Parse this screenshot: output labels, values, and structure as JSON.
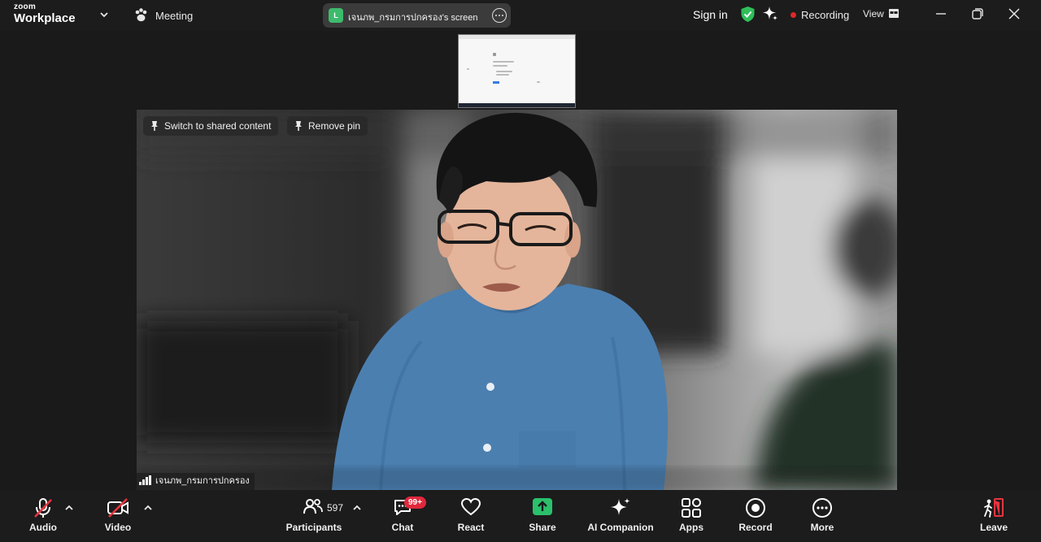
{
  "titlebar": {
    "brand_top": "zoom",
    "brand_bottom": "Workplace",
    "meeting_label": "Meeting",
    "share_avatar_letter": "L",
    "share_label": "เจนภพ_กรมการปกครอง's screen",
    "sign_in": "Sign in",
    "recording_label": "Recording",
    "view_label": "View",
    "accent_green": "#3dbb6c",
    "recording_red": "#e02828"
  },
  "video": {
    "switch_label": "Switch to shared content",
    "remove_pin_label": "Remove pin",
    "participant_name": "เจนภพ_กรมการปกครอง"
  },
  "toolbar": {
    "audio": "Audio",
    "video": "Video",
    "participants": "Participants",
    "participant_count": "597",
    "chat": "Chat",
    "chat_badge": "99+",
    "react": "React",
    "share": "Share",
    "ai_companion": "AI Companion",
    "apps": "Apps",
    "record": "Record",
    "more": "More",
    "leave": "Leave",
    "icons": [
      "mic-muted-icon",
      "camera-off-icon",
      "participants-icon",
      "chat-icon",
      "heart-icon",
      "share-up-arrow-icon",
      "sparkle-icon",
      "apps-icon",
      "record-icon",
      "more-dots-icon",
      "leave-door-icon"
    ]
  }
}
